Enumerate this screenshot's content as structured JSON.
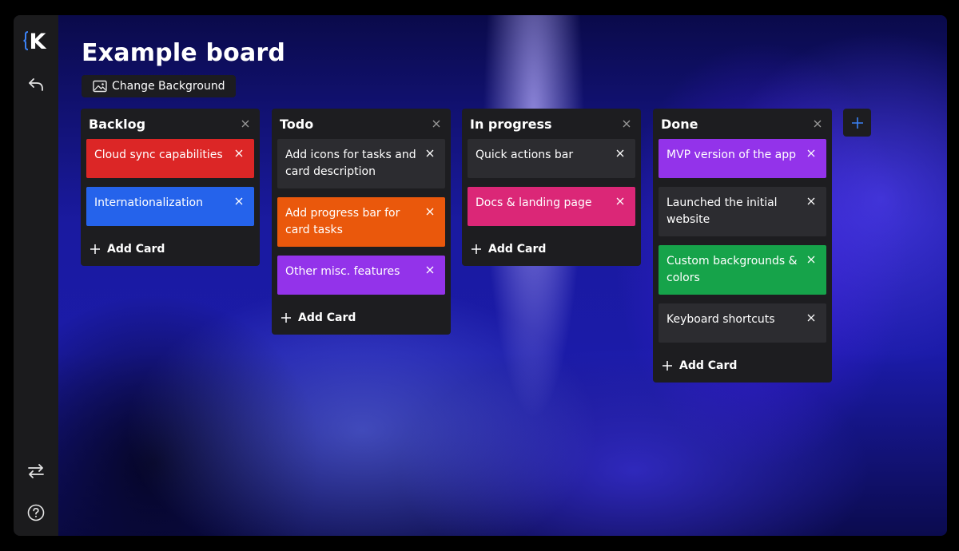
{
  "app": {
    "logo_letter": "K"
  },
  "board": {
    "title": "Example board",
    "change_background_label": "Change Background"
  },
  "add_card_label": "Add Card",
  "columns": [
    {
      "title": "Backlog",
      "cards": [
        {
          "text": "Cloud sync capabilities",
          "color": "#dc2626"
        },
        {
          "text": "Internationalization",
          "color": "#2563eb"
        }
      ]
    },
    {
      "title": "Todo",
      "cards": [
        {
          "text": "Add icons for tasks and card description",
          "color": "#2c2c30"
        },
        {
          "text": "Add progress bar for card tasks",
          "color": "#ea580c"
        },
        {
          "text": "Other misc. features",
          "color": "#9333ea"
        }
      ]
    },
    {
      "title": "In progress",
      "cards": [
        {
          "text": "Quick actions bar",
          "color": "#2c2c30"
        },
        {
          "text": "Docs & landing page",
          "color": "#db2777"
        }
      ]
    },
    {
      "title": "Done",
      "cards": [
        {
          "text": "MVP version of the app",
          "color": "#9333ea"
        },
        {
          "text": "Launched the initial website",
          "color": "#2c2c30"
        },
        {
          "text": "Custom backgrounds & colors",
          "color": "#16a34a"
        },
        {
          "text": "Keyboard shortcuts",
          "color": "#2c2c30"
        }
      ]
    }
  ],
  "colors": {
    "sidebar_bg": "#1b1b1d",
    "column_bg": "#1d1d20",
    "accent": "#3b82f6"
  },
  "icons": {
    "back": "back-arrow-icon",
    "switch": "swap-arrows-icon",
    "help": "help-icon",
    "image": "image-icon",
    "close": "close-icon",
    "add": "plus-icon"
  }
}
